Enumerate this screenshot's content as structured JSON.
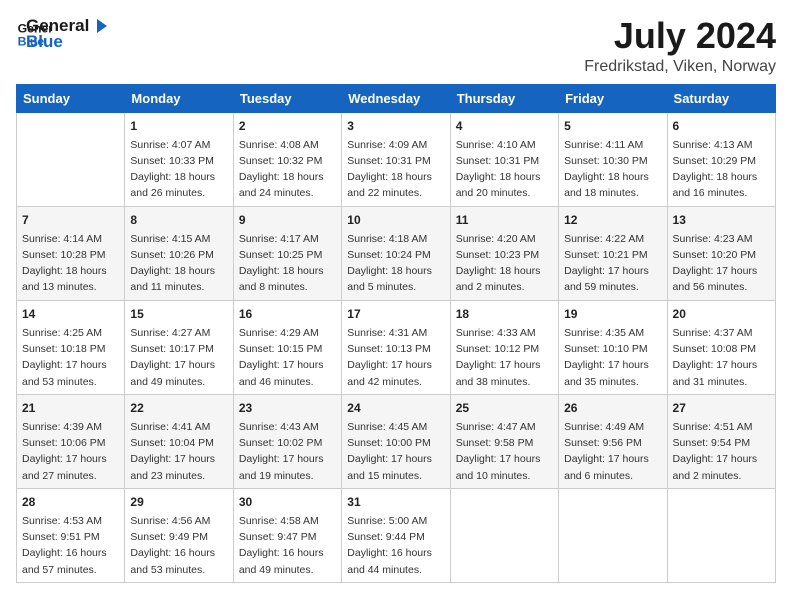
{
  "header": {
    "logo_line1": "General",
    "logo_line2": "Blue",
    "title": "July 2024",
    "location": "Fredrikstad, Viken, Norway"
  },
  "days_of_week": [
    "Sunday",
    "Monday",
    "Tuesday",
    "Wednesday",
    "Thursday",
    "Friday",
    "Saturday"
  ],
  "weeks": [
    [
      {
        "num": "",
        "info": ""
      },
      {
        "num": "1",
        "info": "Sunrise: 4:07 AM\nSunset: 10:33 PM\nDaylight: 18 hours\nand 26 minutes."
      },
      {
        "num": "2",
        "info": "Sunrise: 4:08 AM\nSunset: 10:32 PM\nDaylight: 18 hours\nand 24 minutes."
      },
      {
        "num": "3",
        "info": "Sunrise: 4:09 AM\nSunset: 10:31 PM\nDaylight: 18 hours\nand 22 minutes."
      },
      {
        "num": "4",
        "info": "Sunrise: 4:10 AM\nSunset: 10:31 PM\nDaylight: 18 hours\nand 20 minutes."
      },
      {
        "num": "5",
        "info": "Sunrise: 4:11 AM\nSunset: 10:30 PM\nDaylight: 18 hours\nand 18 minutes."
      },
      {
        "num": "6",
        "info": "Sunrise: 4:13 AM\nSunset: 10:29 PM\nDaylight: 18 hours\nand 16 minutes."
      }
    ],
    [
      {
        "num": "7",
        "info": "Sunrise: 4:14 AM\nSunset: 10:28 PM\nDaylight: 18 hours\nand 13 minutes."
      },
      {
        "num": "8",
        "info": "Sunrise: 4:15 AM\nSunset: 10:26 PM\nDaylight: 18 hours\nand 11 minutes."
      },
      {
        "num": "9",
        "info": "Sunrise: 4:17 AM\nSunset: 10:25 PM\nDaylight: 18 hours\nand 8 minutes."
      },
      {
        "num": "10",
        "info": "Sunrise: 4:18 AM\nSunset: 10:24 PM\nDaylight: 18 hours\nand 5 minutes."
      },
      {
        "num": "11",
        "info": "Sunrise: 4:20 AM\nSunset: 10:23 PM\nDaylight: 18 hours\nand 2 minutes."
      },
      {
        "num": "12",
        "info": "Sunrise: 4:22 AM\nSunset: 10:21 PM\nDaylight: 17 hours\nand 59 minutes."
      },
      {
        "num": "13",
        "info": "Sunrise: 4:23 AM\nSunset: 10:20 PM\nDaylight: 17 hours\nand 56 minutes."
      }
    ],
    [
      {
        "num": "14",
        "info": "Sunrise: 4:25 AM\nSunset: 10:18 PM\nDaylight: 17 hours\nand 53 minutes."
      },
      {
        "num": "15",
        "info": "Sunrise: 4:27 AM\nSunset: 10:17 PM\nDaylight: 17 hours\nand 49 minutes."
      },
      {
        "num": "16",
        "info": "Sunrise: 4:29 AM\nSunset: 10:15 PM\nDaylight: 17 hours\nand 46 minutes."
      },
      {
        "num": "17",
        "info": "Sunrise: 4:31 AM\nSunset: 10:13 PM\nDaylight: 17 hours\nand 42 minutes."
      },
      {
        "num": "18",
        "info": "Sunrise: 4:33 AM\nSunset: 10:12 PM\nDaylight: 17 hours\nand 38 minutes."
      },
      {
        "num": "19",
        "info": "Sunrise: 4:35 AM\nSunset: 10:10 PM\nDaylight: 17 hours\nand 35 minutes."
      },
      {
        "num": "20",
        "info": "Sunrise: 4:37 AM\nSunset: 10:08 PM\nDaylight: 17 hours\nand 31 minutes."
      }
    ],
    [
      {
        "num": "21",
        "info": "Sunrise: 4:39 AM\nSunset: 10:06 PM\nDaylight: 17 hours\nand 27 minutes."
      },
      {
        "num": "22",
        "info": "Sunrise: 4:41 AM\nSunset: 10:04 PM\nDaylight: 17 hours\nand 23 minutes."
      },
      {
        "num": "23",
        "info": "Sunrise: 4:43 AM\nSunset: 10:02 PM\nDaylight: 17 hours\nand 19 minutes."
      },
      {
        "num": "24",
        "info": "Sunrise: 4:45 AM\nSunset: 10:00 PM\nDaylight: 17 hours\nand 15 minutes."
      },
      {
        "num": "25",
        "info": "Sunrise: 4:47 AM\nSunset: 9:58 PM\nDaylight: 17 hours\nand 10 minutes."
      },
      {
        "num": "26",
        "info": "Sunrise: 4:49 AM\nSunset: 9:56 PM\nDaylight: 17 hours\nand 6 minutes."
      },
      {
        "num": "27",
        "info": "Sunrise: 4:51 AM\nSunset: 9:54 PM\nDaylight: 17 hours\nand 2 minutes."
      }
    ],
    [
      {
        "num": "28",
        "info": "Sunrise: 4:53 AM\nSunset: 9:51 PM\nDaylight: 16 hours\nand 57 minutes."
      },
      {
        "num": "29",
        "info": "Sunrise: 4:56 AM\nSunset: 9:49 PM\nDaylight: 16 hours\nand 53 minutes."
      },
      {
        "num": "30",
        "info": "Sunrise: 4:58 AM\nSunset: 9:47 PM\nDaylight: 16 hours\nand 49 minutes."
      },
      {
        "num": "31",
        "info": "Sunrise: 5:00 AM\nSunset: 9:44 PM\nDaylight: 16 hours\nand 44 minutes."
      },
      {
        "num": "",
        "info": ""
      },
      {
        "num": "",
        "info": ""
      },
      {
        "num": "",
        "info": ""
      }
    ]
  ]
}
